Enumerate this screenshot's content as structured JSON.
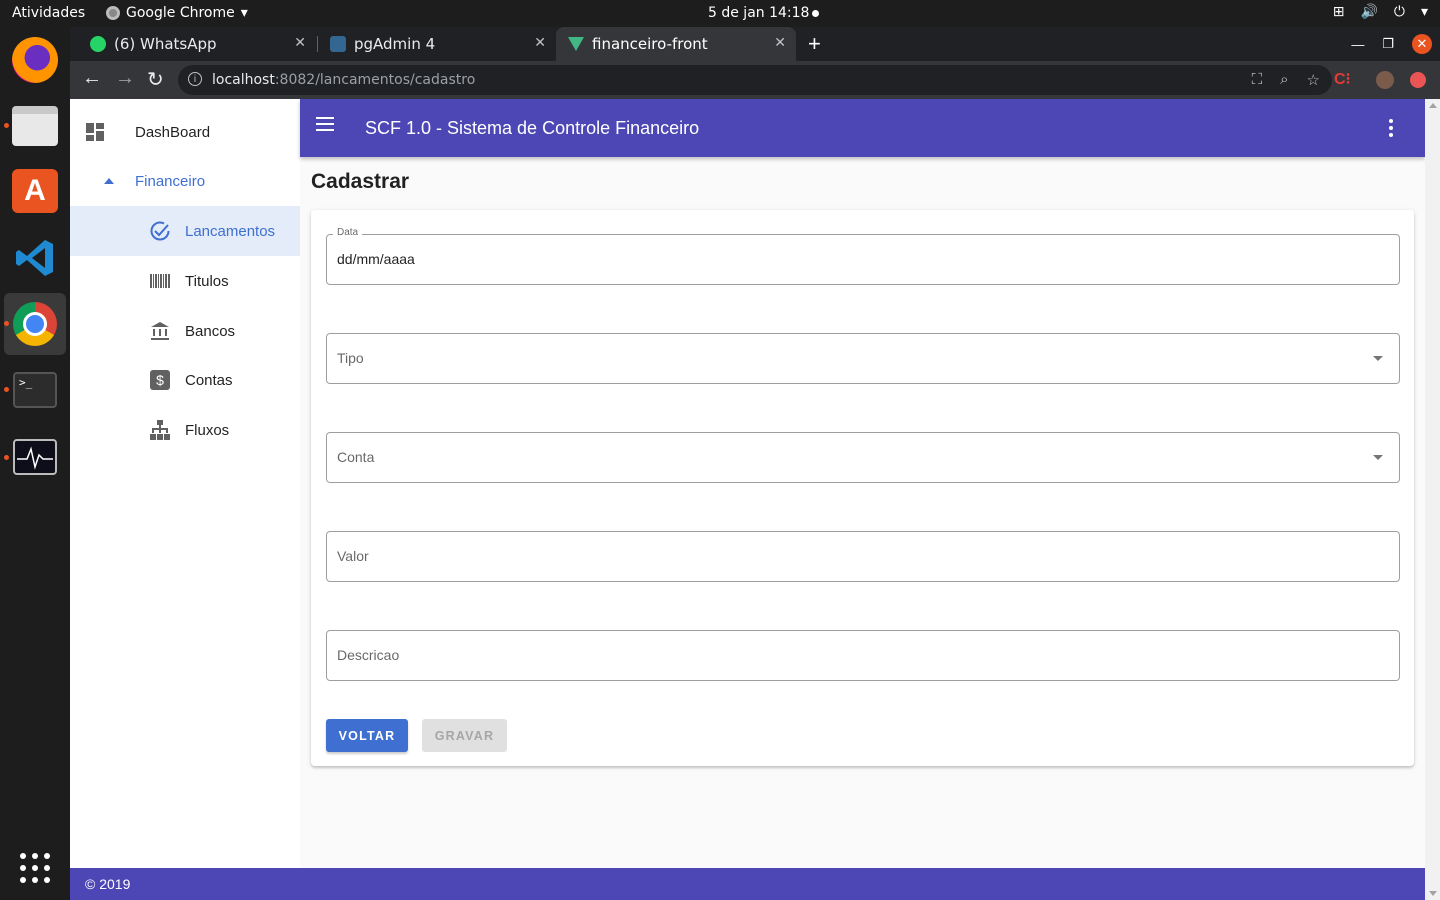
{
  "topbar": {
    "activities": "Atividades",
    "app_name": "Google Chrome",
    "clock": "5 de jan  14:18"
  },
  "browser": {
    "tabs": [
      {
        "title": "(6) WhatsApp"
      },
      {
        "title": "pgAdmin 4"
      },
      {
        "title": "financeiro-front"
      }
    ],
    "url_host": "localhost",
    "url_rest": ":8082/lancamentos/cadastro"
  },
  "drawer": {
    "items": [
      {
        "label": "DashBoard"
      },
      {
        "label": "Financeiro"
      },
      {
        "label": "Lancamentos"
      },
      {
        "label": "Titulos"
      },
      {
        "label": "Bancos"
      },
      {
        "label": "Contas"
      },
      {
        "label": "Fluxos"
      }
    ]
  },
  "appbar": {
    "title": "SCF 1.0 - Sistema de Controle Financeiro"
  },
  "page": {
    "heading": "Cadastrar"
  },
  "form": {
    "data_label": "Data",
    "data_value": "dd/mm/aaaa",
    "tipo_label": "Tipo",
    "conta_label": "Conta",
    "valor_label": "Valor",
    "descricao_label": "Descricao",
    "voltar_label": "VOLTAR",
    "gravar_label": "GRAVAR"
  },
  "footer": {
    "text": "© 2019"
  },
  "colors": {
    "appbar": "#4d47b5",
    "primary": "#3f6fd1",
    "active_nav_bg": "#e3ecf8"
  }
}
